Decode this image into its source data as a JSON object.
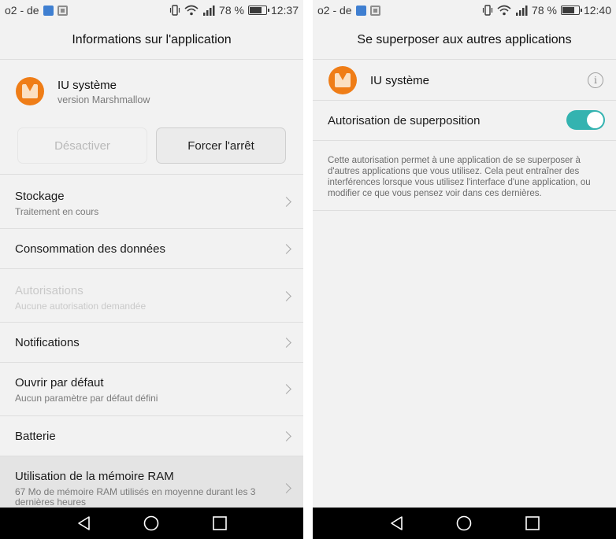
{
  "left": {
    "status": {
      "carrier": "o2 - de",
      "battery_pct": "78 %",
      "battery_level": 0.78,
      "time": "12:37"
    },
    "title": "Informations sur l'application",
    "app": {
      "name": "IU système",
      "version": "version Marshmallow"
    },
    "buttons": {
      "disable": "Désactiver",
      "force_stop": "Forcer l'arrêt"
    },
    "items": [
      {
        "title": "Stockage",
        "sub": "Traitement en cours",
        "state": "normal"
      },
      {
        "title": "Consommation des données",
        "sub": "",
        "state": "normal"
      },
      {
        "title": "Autorisations",
        "sub": "Aucune autorisation demandée",
        "state": "disabled"
      },
      {
        "title": "Notifications",
        "sub": "",
        "state": "normal"
      },
      {
        "title": "Ouvrir par défaut",
        "sub": "Aucun paramètre par défaut défini",
        "state": "normal"
      },
      {
        "title": "Batterie",
        "sub": "",
        "state": "normal"
      },
      {
        "title": "Utilisation de la mémoire RAM",
        "sub": "67  Mo de mémoire RAM utilisés en moyenne durant les 3 dernières heures",
        "state": "pressed"
      }
    ]
  },
  "right": {
    "status": {
      "carrier": "o2 - de",
      "battery_pct": "78 %",
      "battery_level": 0.78,
      "time": "12:40"
    },
    "title": "Se superposer aux autres applications",
    "app": {
      "name": "IU système"
    },
    "toggle": {
      "label": "Autorisation de superposition",
      "on": true
    },
    "description": "Cette autorisation permet à une application de se superposer à d'autres applications que vous utilisez. Cela peut entraîner des interférences lorsque vous utilisez l'interface d'une application, ou modifier ce que vous pensez voir dans ces dernières."
  },
  "colors": {
    "accent_toggle": "#34b3b0",
    "app_icon": "#ef7d17",
    "nav_bar": "#000000"
  },
  "icons": [
    "vibrate-icon",
    "wifi-icon",
    "signal-icon",
    "battery-icon",
    "back-icon",
    "home-icon",
    "recents-icon",
    "info-icon",
    "chevron-right-icon",
    "marshmallow-app-icon"
  ]
}
